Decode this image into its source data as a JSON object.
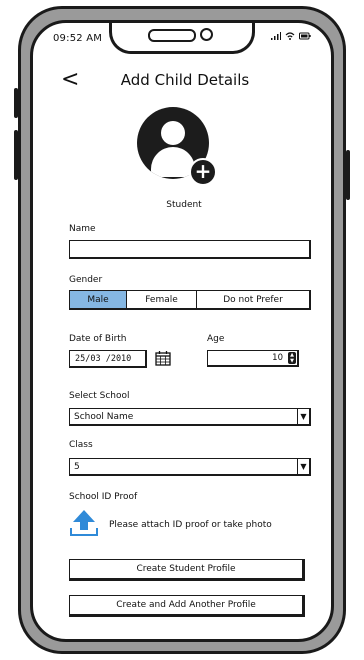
{
  "status_bar": {
    "time": "09:52 AM"
  },
  "header": {
    "back_icon": "chevron-left-icon",
    "back_glyph": "<",
    "title": "Add Child Details"
  },
  "avatar": {
    "label": "Student",
    "add_glyph": "+"
  },
  "form": {
    "name": {
      "label": "Name",
      "value": ""
    },
    "gender": {
      "label": "Gender",
      "options": [
        "Male",
        "Female",
        "Do not Prefer"
      ],
      "selected": "Male"
    },
    "dob": {
      "label": "Date of Birth",
      "value": "25/03 /2010"
    },
    "age": {
      "label": "Age",
      "value": "10"
    },
    "school": {
      "label": "Select School",
      "value": "School Name"
    },
    "class": {
      "label": "Class",
      "value": "5"
    },
    "id_proof": {
      "label": "School ID Proof",
      "hint": "Please attach ID proof or take photo"
    }
  },
  "actions": {
    "create_profile": "Create Student Profile",
    "create_and_add": "Create and Add Another Profile"
  },
  "colors": {
    "selected_segment": "#85b7e3",
    "upload_icon": "#2f8ad8",
    "frame": "#9a9a9a"
  }
}
